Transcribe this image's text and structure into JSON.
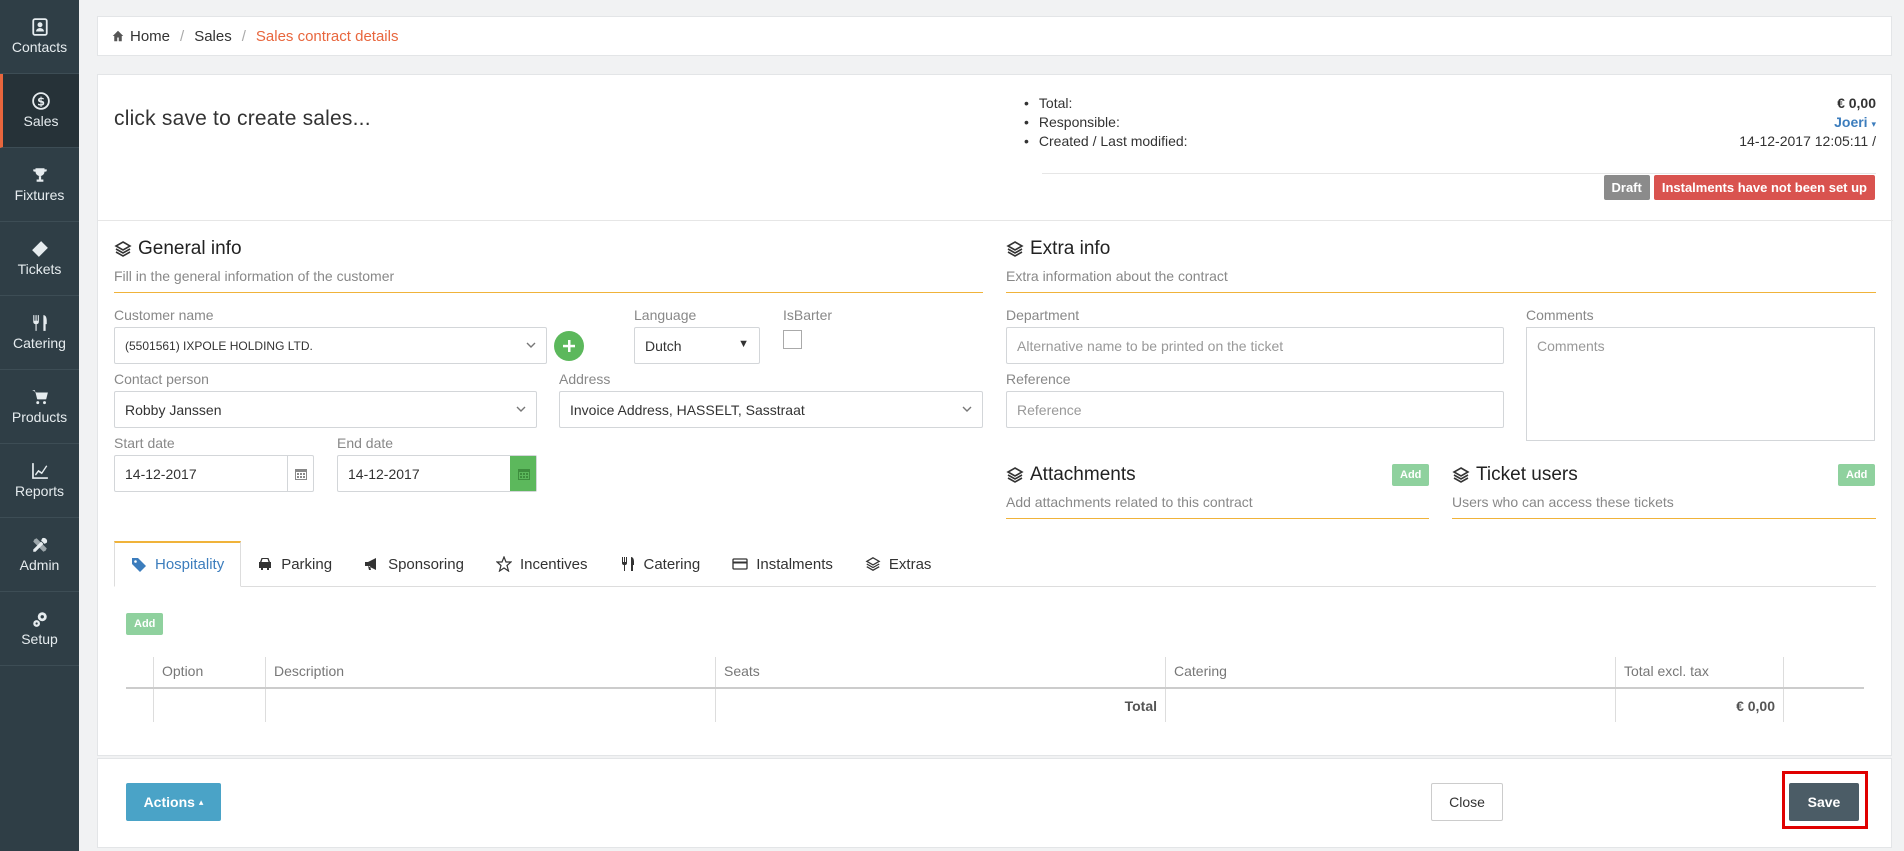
{
  "sidebar": {
    "items": [
      {
        "label": "Contacts",
        "icon": "contacts-icon"
      },
      {
        "label": "Sales",
        "icon": "dollar-icon"
      },
      {
        "label": "Fixtures",
        "icon": "trophy-icon"
      },
      {
        "label": "Tickets",
        "icon": "ticket-icon"
      },
      {
        "label": "Catering",
        "icon": "cutlery-icon"
      },
      {
        "label": "Products",
        "icon": "cart-icon"
      },
      {
        "label": "Reports",
        "icon": "chart-icon"
      },
      {
        "label": "Admin",
        "icon": "tools-icon"
      },
      {
        "label": "Setup",
        "icon": "gears-icon"
      }
    ]
  },
  "breadcrumb": {
    "home": "Home",
    "sales": "Sales",
    "current": "Sales contract details"
  },
  "header": {
    "title": "click save to create sales...",
    "total_label": "Total:",
    "total_value": "€ 0,00",
    "responsible_label": "Responsible:",
    "responsible_value": "Joeri",
    "created_label": "Created / Last modified:",
    "created_value": "14-12-2017 12:05:11 /",
    "badge_draft": "Draft",
    "badge_instalments": "Instalments have not been set up"
  },
  "general": {
    "title": "General info",
    "subtitle": "Fill in the general information of the customer",
    "customer_label": "Customer name",
    "customer_value": "(5501561) IXPOLE HOLDING LTD.",
    "language_label": "Language",
    "language_value": "Dutch",
    "isbarter_label": "IsBarter",
    "contact_label": "Contact person",
    "contact_value": "Robby Janssen",
    "address_label": "Address",
    "address_value": "Invoice Address, HASSELT, Sasstraat",
    "start_label": "Start date",
    "start_value": "14-12-2017",
    "end_label": "End date",
    "end_value": "14-12-2017"
  },
  "extra": {
    "title": "Extra info",
    "subtitle": "Extra information about the contract",
    "department_label": "Department",
    "department_placeholder": "Alternative name to be printed on the ticket",
    "reference_label": "Reference",
    "reference_placeholder": "Reference",
    "comments_label": "Comments",
    "comments_placeholder": "Comments"
  },
  "attachments": {
    "title": "Attachments",
    "subtitle": "Add attachments related to this contract",
    "add": "Add"
  },
  "ticket_users": {
    "title": "Ticket users",
    "subtitle": "Users who can access these tickets",
    "add": "Add"
  },
  "tabs": [
    "Hospitality",
    "Parking",
    "Sponsoring",
    "Incentives",
    "Catering",
    "Instalments",
    "Extras"
  ],
  "table": {
    "add": "Add",
    "headers": [
      "",
      "Option",
      "Description",
      "Seats",
      "Catering",
      "Total excl. tax",
      ""
    ],
    "total_label": "Total",
    "total_value": "€ 0,00"
  },
  "footer": {
    "actions": "Actions",
    "close": "Close",
    "save": "Save"
  },
  "colors": {
    "accent": "#e8663d",
    "sidebar": "#2f3e46",
    "success": "#5cb85c",
    "info": "#4aa3c7",
    "danger": "#d9534f"
  }
}
